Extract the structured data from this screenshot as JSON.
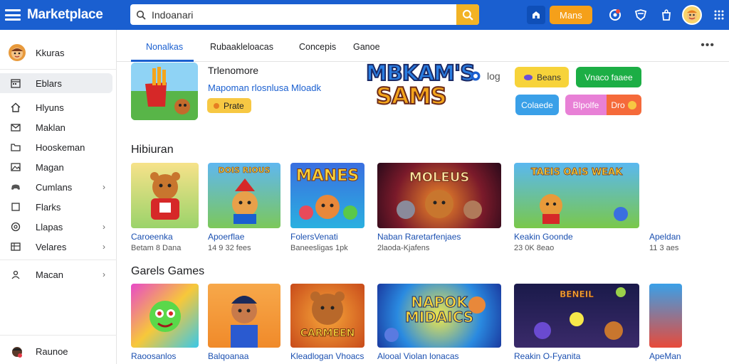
{
  "app": {
    "brand": "Marketplace"
  },
  "search": {
    "value": "Indoanari",
    "placeholder": ""
  },
  "topbar": {
    "promo_label": "Mans"
  },
  "sidebar": {
    "user_label": "Kkuras",
    "items": [
      {
        "label": "Eblars",
        "icon": "calendar-icon",
        "active": true,
        "chevron": false
      },
      {
        "label": "Hlyuns",
        "icon": "home-icon",
        "active": false,
        "chevron": false
      },
      {
        "label": "Maklan",
        "icon": "mail-icon",
        "active": false,
        "chevron": false
      },
      {
        "label": "Hooskeman",
        "icon": "folder-icon",
        "active": false,
        "chevron": false
      },
      {
        "label": "Magan",
        "icon": "image-icon",
        "active": false,
        "chevron": false
      },
      {
        "label": "Cumlans",
        "icon": "gamepad-icon",
        "active": false,
        "chevron": true
      },
      {
        "label": "Flarks",
        "icon": "square-icon",
        "active": false,
        "chevron": false
      },
      {
        "label": "Llapas",
        "icon": "circle-icon",
        "active": false,
        "chevron": true
      },
      {
        "label": "Velares",
        "icon": "grid-icon",
        "active": false,
        "chevron": true
      },
      {
        "label": "Macan",
        "icon": "person-icon",
        "active": false,
        "chevron": true
      }
    ],
    "bottom_label": "Raunoe"
  },
  "tabs": [
    "Nonalkas",
    "Rubaakleloacas",
    "Concepis",
    "Ganoe"
  ],
  "featured": {
    "title": "Trlenomore",
    "subtitle": "Mapoman rlosnlusa Mloadk",
    "badge": "Prate",
    "logo_line1": "MBKAM'S",
    "logo_line2": "SAMS",
    "rating": "log",
    "pills": [
      "Beans",
      "Vnaco faaee",
      "Colaede",
      "Blpolfe",
      "Dro"
    ]
  },
  "section1": {
    "title": "Hibiuran",
    "cards": [
      {
        "title": "Caroeenka",
        "meta": "Betam 8 Dana",
        "art": ""
      },
      {
        "title": "Apoerflae",
        "meta": "14 9 32 fees",
        "art": "DOIS RIOUS"
      },
      {
        "title": "FolersVenati",
        "meta": "Baneesligas 1pk",
        "art": "MANES"
      },
      {
        "title": "Naban Raretarfenjaes",
        "meta": "2laoda-Kjafens",
        "art": "MOLEUS"
      },
      {
        "title": "Keakin Goonde",
        "meta": "23 0K 8eao",
        "art": "TAEIS OAIS  WEAK"
      },
      {
        "title": "Apeldan",
        "meta": "11 3 aes",
        "art": ""
      }
    ]
  },
  "section2": {
    "title": "Garels Games",
    "cards": [
      {
        "title": "Raoosanlos",
        "art": ""
      },
      {
        "title": "Balqoanaa",
        "art": ""
      },
      {
        "title": "Kleadlogan Vhoacs",
        "art": "CARMEEN"
      },
      {
        "title": "Alooal Violan lonacas",
        "art": "NAPOK MIDAICS"
      },
      {
        "title": "Reakin O-Fyanita",
        "art": "BENEIL"
      },
      {
        "title": "ApeMan",
        "art": ""
      }
    ]
  },
  "colors": {
    "topbar": "#1a5fd0",
    "accent": "#f5a01a",
    "link": "#1a4fb0",
    "search_button": "#f2b325"
  }
}
